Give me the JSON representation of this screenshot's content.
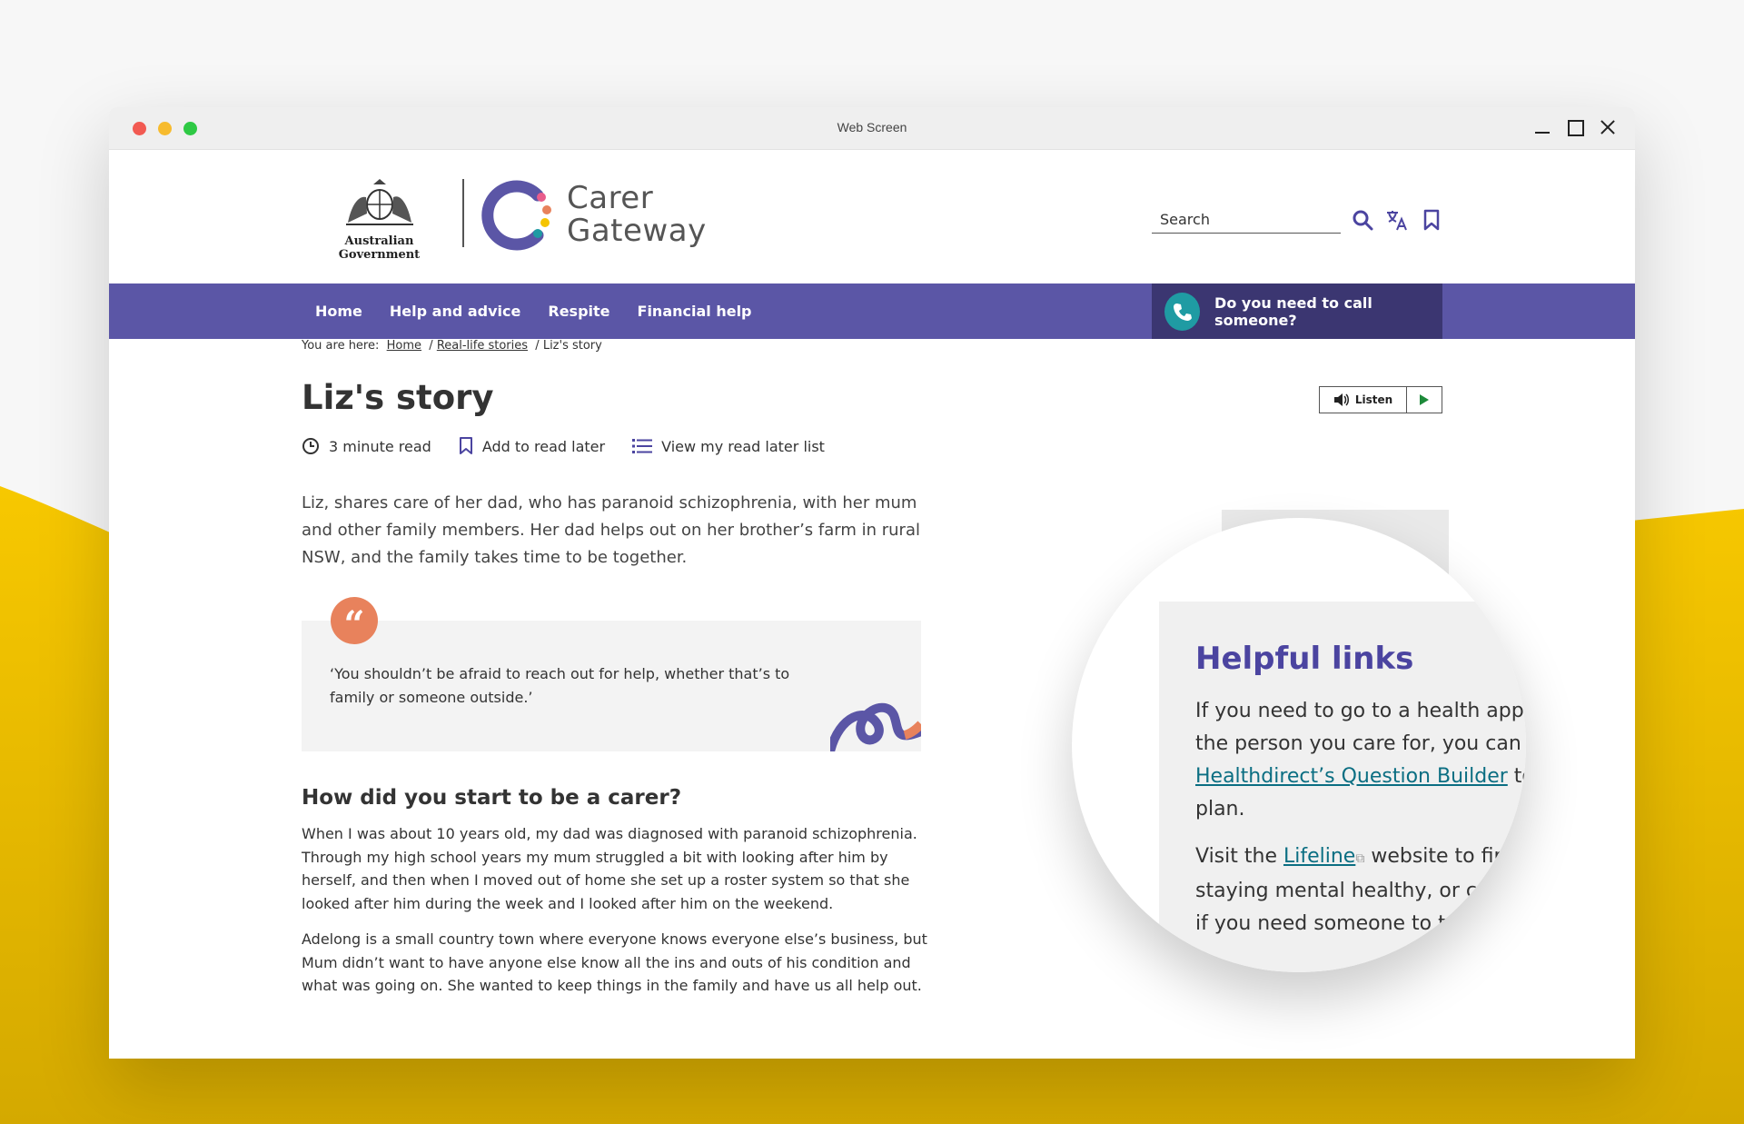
{
  "window": {
    "title": "Web Screen"
  },
  "header": {
    "gov_name": "Australian Government",
    "brand_line1": "Carer",
    "brand_line2": "Gateway",
    "search_placeholder": "Search"
  },
  "nav": {
    "items": [
      "Home",
      "Help and advice",
      "Respite",
      "Financial help"
    ],
    "call_label": "Do you need to call someone?"
  },
  "breadcrumb": {
    "prefix": "You are here:",
    "home": "Home",
    "sep1": "/",
    "stories": "Real-life stories",
    "sep2": "/",
    "current": "Liz's story"
  },
  "listen": {
    "label": "Listen"
  },
  "article": {
    "title": "Liz's story",
    "read_time": "3 minute read",
    "add_read_later": "Add to read later",
    "view_list": "View my read later list",
    "intro": "Liz, shares care of her dad, who has paranoid schizophrenia, with her mum and other family members. Her dad helps out on her brother’s farm in rural NSW, and the family takes time to be together.",
    "quote": "‘You shouldn’t be afraid to reach out for help, whether that’s to family or someone outside.’",
    "quote_mark": "“",
    "section1_title": "How did you start to be a carer?",
    "para1": "When I was about 10 years old, my dad was diagnosed with paranoid schizophrenia. Through my high school years my mum struggled a bit with looking after him by herself, and then when I moved out of home she set up a roster system so that she looked after him during the week and I looked after him on the weekend.",
    "para2": "Adelong is a small country town where everyone knows everyone else’s business, but Mum didn’t want to have anyone else know all the ins and outs of his condition and what was going on. She wanted to keep things in the family and have us all help out."
  },
  "helpful_links": {
    "title": "Helpful links",
    "line1": "If you need to go to a health appoi",
    "line2": "the person you care for, you can us",
    "link1": "Healthdirect’s Question Builder",
    "line3_tail": " to",
    "line4": "plan.",
    "line5_pre": "Visit the ",
    "link2": "Lifeline",
    "line5_tail": " website to fin",
    "line6": "staying mental healthy, or call",
    "line7": "if you need someone to ta"
  },
  "colors": {
    "nav_purple": "#5b56a6",
    "call_dark": "#3b3671",
    "brand_purple": "#4b44a0",
    "teal": "#1f9ba3",
    "quote_orange": "#e8825c",
    "background_yellow": "#f5c400"
  },
  "icons": {
    "search": "search-icon",
    "translate": "translate-icon",
    "bookmark": "bookmark-icon",
    "phone": "phone-icon",
    "clock": "clock-icon",
    "list": "list-icon",
    "speaker": "speaker-icon",
    "play": "play-icon",
    "external": "external-link-icon"
  }
}
